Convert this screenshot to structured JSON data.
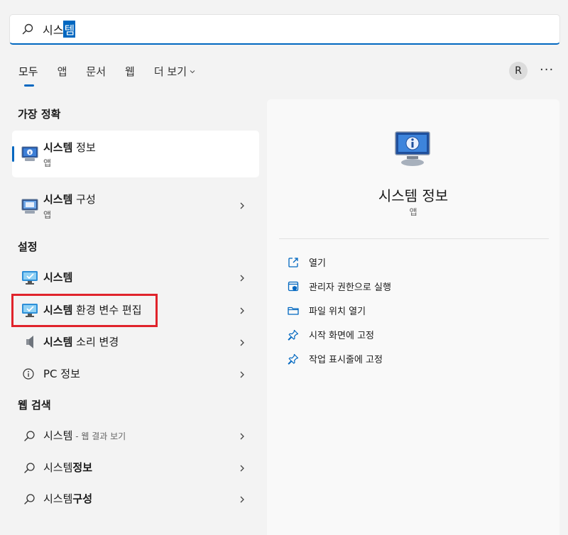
{
  "search": {
    "query_prefix": "시스",
    "query_selected": "템"
  },
  "tabs": [
    {
      "label": "모두"
    },
    {
      "label": "앱"
    },
    {
      "label": "문서"
    },
    {
      "label": "웹"
    },
    {
      "label": "더 보기"
    }
  ],
  "avatar_initial": "R",
  "more_menu": "···",
  "sections": {
    "best_match": "가장 정확",
    "settings": "설정",
    "web_search": "웹 검색"
  },
  "best_match": {
    "bold": "시스템",
    "rest": " 정보",
    "type": "앱"
  },
  "apps": [
    {
      "bold": "시스템",
      "rest": " 구성",
      "type": "앱"
    }
  ],
  "settings": [
    {
      "bold": "시스템",
      "rest": ""
    },
    {
      "bold": "시스템",
      "rest": " 환경 변수 편집"
    },
    {
      "bold": "시스템",
      "rest": " 소리 변경"
    },
    {
      "bold": "",
      "rest": "PC 정보"
    }
  ],
  "web": [
    {
      "plain": "시스템",
      "bold": "",
      "suffix": " - 웹 결과 보기"
    },
    {
      "plain": "시스템",
      "bold": "정보",
      "suffix": ""
    },
    {
      "plain": "시스템",
      "bold": "구성",
      "suffix": ""
    }
  ],
  "panel": {
    "title": "시스템 정보",
    "subtitle": "앱",
    "actions": [
      {
        "label": "열기",
        "icon": "open-external-icon"
      },
      {
        "label": "관리자 권한으로 실행",
        "icon": "run-as-admin-icon"
      },
      {
        "label": "파일 위치 열기",
        "icon": "folder-icon"
      },
      {
        "label": "시작 화면에 고정",
        "icon": "pin-icon"
      },
      {
        "label": "작업 표시줄에 고정",
        "icon": "pin-icon"
      }
    ]
  },
  "colors": {
    "accent": "#0067c0",
    "highlight_border": "#e0232b"
  }
}
